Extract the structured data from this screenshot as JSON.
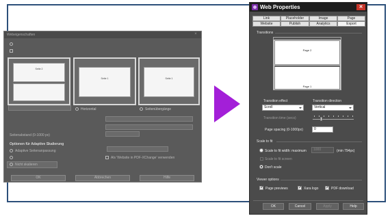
{
  "left_dialog": {
    "title": "Webeigenschaften",
    "close": "×",
    "thumbnails": [
      {
        "page": "Seite 2"
      },
      {
        "page": "Seite 1"
      },
      {
        "page": "Seite 1"
      }
    ],
    "view_options": [
      "Vertikal",
      "Horizontal",
      "Seitenübergänge"
    ],
    "page_spacing_label": "Seitenabstand (0-1000 px)",
    "adaptive_heading": "Optionen für Adaptive Skalierung",
    "adaptive_check": "Adaptive Seitenanpassung",
    "do_not_scale": "Nicht skalieren",
    "link_check": "Als 'Website in PDF-XChange' verwenden",
    "buttons": [
      "OK",
      "Abbrechen",
      "Hilfe"
    ]
  },
  "dialog": {
    "title": "Web Properties",
    "close_label": "✕",
    "tabs_row1": [
      "Link",
      "Placeholder",
      "Image",
      "Page"
    ],
    "tabs_row2": [
      "Website",
      "Publish",
      "Analytics",
      "Export"
    ],
    "selected_tab": "Export",
    "transitions": {
      "section_label": "Transitions",
      "preview_page_top": "Page 2",
      "preview_page_bottom": "Page 1",
      "effect_label": "Transition effect",
      "effect_value": "Scroll",
      "direction_label": "Transition direction",
      "direction_value": "Vertical",
      "time_label": "Transition time (secs)",
      "slider_value": 0.2,
      "spacing_label": "Page spacing (0-1000px)",
      "spacing_value": "0"
    },
    "scale": {
      "section_label": "Scale to fit",
      "option_max": "Scale to fit width: maximum",
      "max_value": "1000",
      "min_note": "(min 794px)",
      "option_screen": "Scale to fit screen",
      "option_dont": "Don't scale",
      "selected": "Don't scale"
    },
    "viewer": {
      "section_label": "Viewer options",
      "page_previews": "Page previews",
      "xara_logo": "Xara logo",
      "pdf_download": "PDF download",
      "page_previews_checked": true,
      "xara_logo_checked": true,
      "pdf_download_checked": true
    },
    "buttons": {
      "ok": "OK",
      "cancel": "Cancel",
      "apply": "Apply",
      "help": "Help"
    },
    "check_glyph": "✓"
  },
  "colors": {
    "arrow": "#a31fd8",
    "frame": "#2c4f7a",
    "dialog_bg": "#4b4b4b",
    "close": "#c8362a"
  }
}
